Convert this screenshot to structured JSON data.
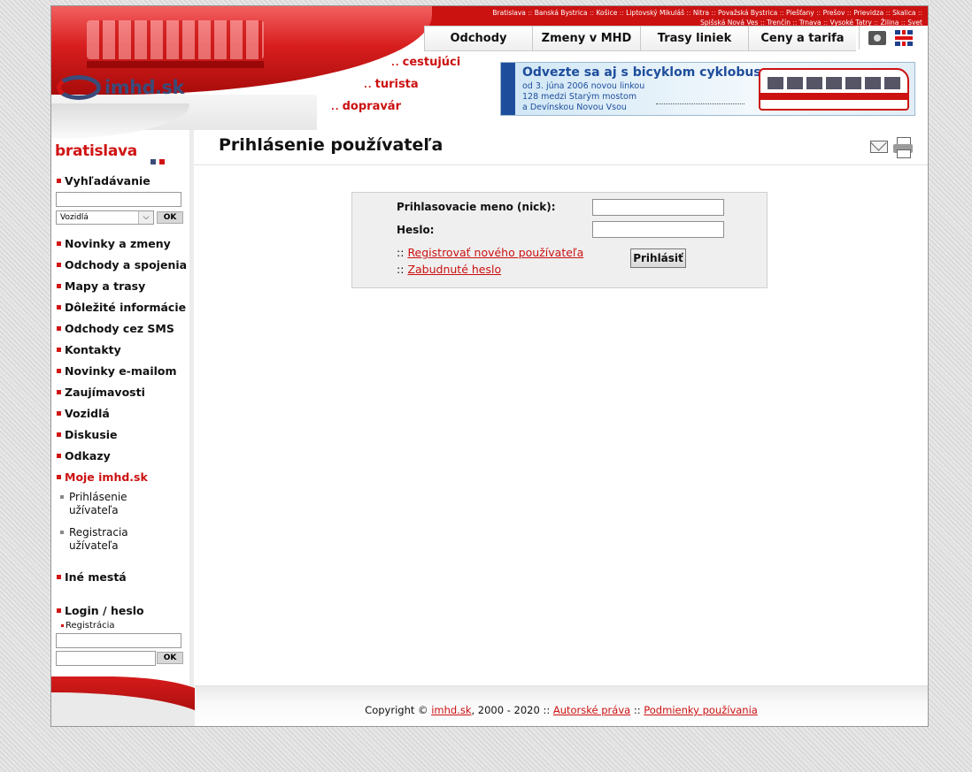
{
  "header": {
    "cities_line1": [
      "Bratislava",
      "Banská Bystrica",
      "Košice",
      "Liptovský Mikuláš",
      "Nitra",
      "Považská Bystrica",
      "Piešťany",
      "Prešov",
      "Prievidza",
      "Skalica"
    ],
    "cities_line2": [
      "Spišská Nová Ves",
      "Trenčín",
      "Trnava",
      "Vysoké Tatry",
      "Žilina",
      "Svet"
    ],
    "separator": "::",
    "nav": [
      "Odchody",
      "Zmeny v MHD",
      "Trasy liniek",
      "Ceny a tarifa"
    ],
    "logo_text": "imhd.sk",
    "audience": [
      "cestujúci",
      "turista",
      "dopravár"
    ],
    "banner": {
      "title": "Odvezte sa aj s bicyklom cyklobusom",
      "lines": [
        "od 3. júna 2006 novou linkou",
        "128 medzi Starým mostom",
        "a Devínskou Novou Vsou"
      ]
    }
  },
  "sidebar": {
    "city": "bratislava",
    "search_label": "Vyhľadávanie",
    "search_select": "Vozidlá",
    "ok": "OK",
    "menu": [
      "Novinky a zmeny",
      "Odchody a spojenia",
      "Mapy a trasy",
      "Dôležité informácie",
      "Odchody cez SMS",
      "Kontakty",
      "Novinky e-mailom",
      "Zaujímavosti",
      "Vozidlá",
      "Diskusie",
      "Odkazy"
    ],
    "active": "Moje imhd.sk",
    "sub": [
      "Prihlásenie užívateľa",
      "Registracia užívateľa"
    ],
    "other": "Iné mestá",
    "login_label": "Login / heslo",
    "register": "Registrácia"
  },
  "main": {
    "title": "Prihlásenie používateľa",
    "form": {
      "nick_label": "Prihlasovacie meno (nick):",
      "pass_label": "Heslo:",
      "link_prefix": "::",
      "register_link": "Registrovať nového používateľa",
      "forgot_link": "Zabudnuté heslo",
      "submit": "Prihlásiť"
    }
  },
  "footer": {
    "copyright": "Copyright ©",
    "site": "imhd.sk",
    "years": ", 2000 - 2020 ::",
    "authors": "Autorské práva",
    "sep": "::",
    "terms": "Podmienky používania"
  }
}
